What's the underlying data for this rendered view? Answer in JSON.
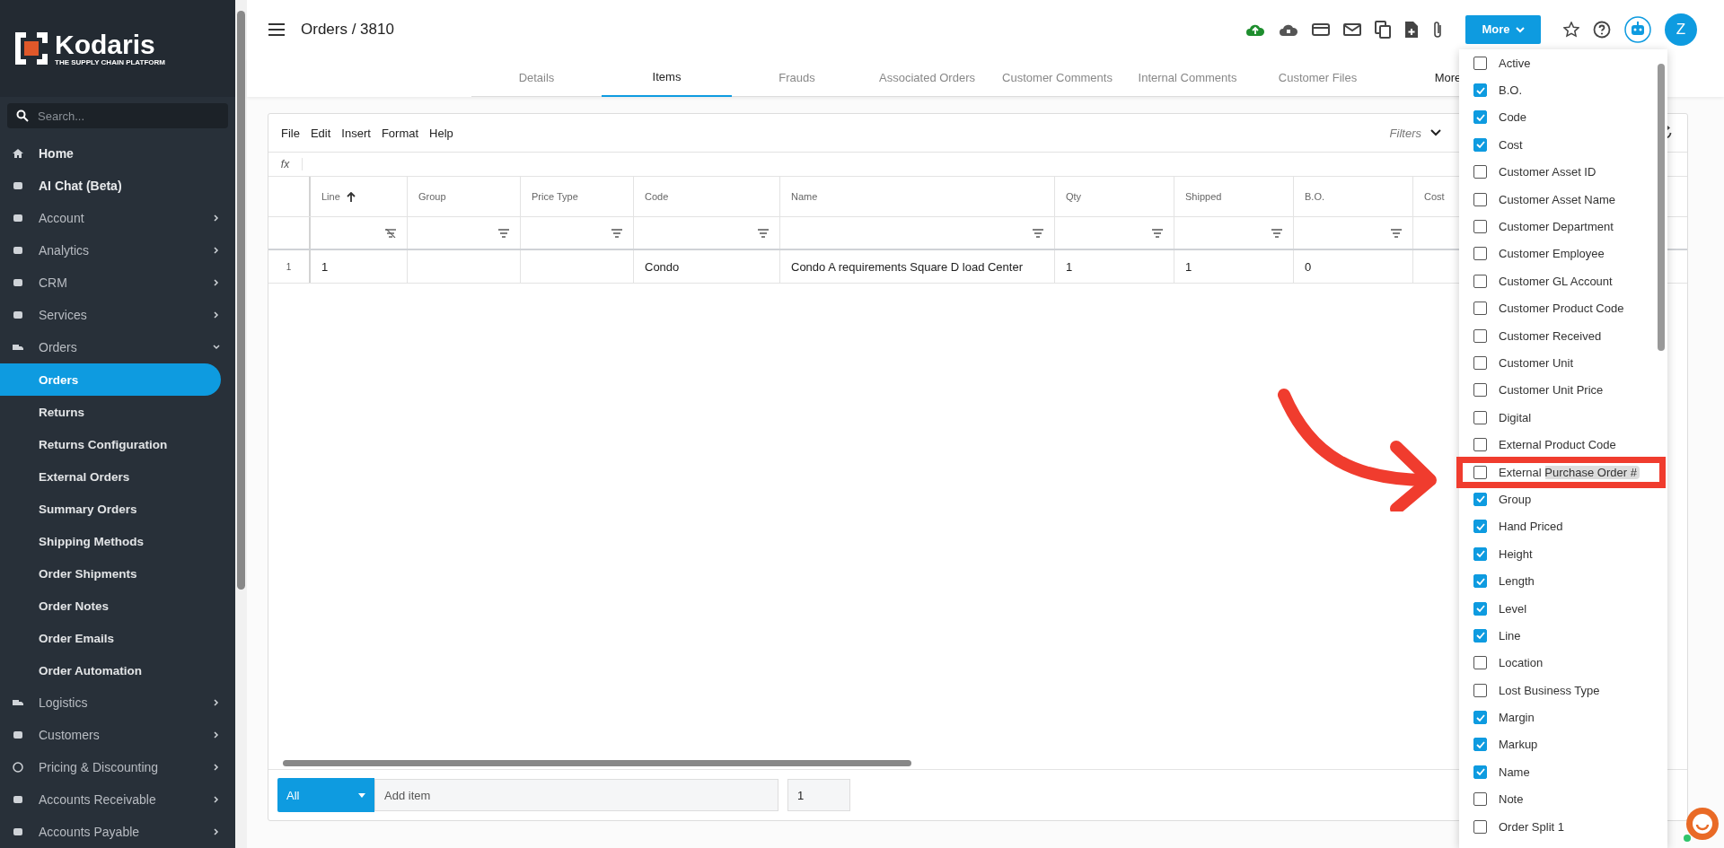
{
  "sidebar": {
    "logo": {
      "name": "Kodaris",
      "tagline": "THE SUPPLY CHAIN PLATFORM"
    },
    "search": {
      "placeholder": "Search..."
    },
    "items": [
      {
        "label": "Home",
        "kind": "link"
      },
      {
        "label": "AI Chat (Beta)",
        "kind": "link"
      },
      {
        "label": "Account",
        "kind": "group",
        "expanded": false
      },
      {
        "label": "Analytics",
        "kind": "group",
        "expanded": false
      },
      {
        "label": "CRM",
        "kind": "group",
        "expanded": false
      },
      {
        "label": "Services",
        "kind": "group",
        "expanded": false
      },
      {
        "label": "Orders",
        "kind": "group",
        "expanded": true,
        "children": [
          {
            "label": "Orders",
            "selected": true
          },
          {
            "label": "Returns",
            "selected": false
          },
          {
            "label": "Returns Configuration",
            "selected": false
          },
          {
            "label": "External Orders",
            "selected": false
          },
          {
            "label": "Summary Orders",
            "selected": false
          },
          {
            "label": "Shipping Methods",
            "selected": false
          },
          {
            "label": "Order Shipments",
            "selected": false
          },
          {
            "label": "Order Notes",
            "selected": false
          },
          {
            "label": "Order Emails",
            "selected": false
          },
          {
            "label": "Order Automation",
            "selected": false
          }
        ]
      },
      {
        "label": "Logistics",
        "kind": "group",
        "expanded": false
      },
      {
        "label": "Customers",
        "kind": "group",
        "expanded": false
      },
      {
        "label": "Pricing & Discounting",
        "kind": "group",
        "expanded": false
      },
      {
        "label": "Accounts Receivable",
        "kind": "group",
        "expanded": false
      },
      {
        "label": "Accounts Payable",
        "kind": "group",
        "expanded": false
      }
    ]
  },
  "header": {
    "title": "Orders / 3810",
    "more_button": "More",
    "avatar": "Z"
  },
  "tabs": [
    {
      "label": "Details",
      "selected": false
    },
    {
      "label": "Items",
      "selected": true
    },
    {
      "label": "Frauds",
      "selected": false
    },
    {
      "label": "Associated Orders",
      "selected": false
    },
    {
      "label": "Customer Comments",
      "selected": false
    },
    {
      "label": "Internal Comments",
      "selected": false
    },
    {
      "label": "Customer Files",
      "selected": false
    },
    {
      "label": "More",
      "selected": false
    }
  ],
  "sheet": {
    "menu": [
      "File",
      "Edit",
      "Insert",
      "Format",
      "Help"
    ],
    "filters": "Filters",
    "formula_label": "fx",
    "columns": [
      {
        "label": "Line",
        "sorted": true
      },
      {
        "label": "Group",
        "sorted": false
      },
      {
        "label": "Price Type",
        "sorted": false
      },
      {
        "label": "Code",
        "sorted": false
      },
      {
        "label": "Name",
        "sorted": false
      },
      {
        "label": "Qty",
        "sorted": false
      },
      {
        "label": "Shipped",
        "sorted": false
      },
      {
        "label": "B.O.",
        "sorted": false
      },
      {
        "label": "Cost",
        "sorted": false
      }
    ],
    "rows": [
      {
        "number": "1",
        "cells": [
          "1",
          "",
          "",
          "Condo",
          "Condo A requirements Square D load Center",
          "1",
          "1",
          "0",
          ""
        ]
      }
    ],
    "footer": {
      "type_select": "All",
      "add_placeholder": "Add item",
      "quantity": "1"
    }
  },
  "column_menu": [
    {
      "label": "Active",
      "checked": false,
      "highlighted": false
    },
    {
      "label": "B.O.",
      "checked": true,
      "highlighted": false
    },
    {
      "label": "Code",
      "checked": true,
      "highlighted": false
    },
    {
      "label": "Cost",
      "checked": true,
      "highlighted": false
    },
    {
      "label": "Customer Asset ID",
      "checked": false,
      "highlighted": false
    },
    {
      "label": "Customer Asset Name",
      "checked": false,
      "highlighted": false
    },
    {
      "label": "Customer Department",
      "checked": false,
      "highlighted": false
    },
    {
      "label": "Customer Employee",
      "checked": false,
      "highlighted": false
    },
    {
      "label": "Customer GL Account",
      "checked": false,
      "highlighted": false
    },
    {
      "label": "Customer Product Code",
      "checked": false,
      "highlighted": false
    },
    {
      "label": "Customer Received",
      "checked": false,
      "highlighted": false
    },
    {
      "label": "Customer Unit",
      "checked": false,
      "highlighted": false
    },
    {
      "label": "Customer Unit Price",
      "checked": false,
      "highlighted": false
    },
    {
      "label": "Digital",
      "checked": false,
      "highlighted": false
    },
    {
      "label": "External Product Code",
      "checked": false,
      "highlighted": false
    },
    {
      "label": "External Purchase Order #",
      "checked": false,
      "highlighted": true,
      "annotated": true
    },
    {
      "label": "Group",
      "checked": true,
      "highlighted": false
    },
    {
      "label": "Hand Priced",
      "checked": true,
      "highlighted": false
    },
    {
      "label": "Height",
      "checked": true,
      "highlighted": false
    },
    {
      "label": "Length",
      "checked": true,
      "highlighted": false
    },
    {
      "label": "Level",
      "checked": true,
      "highlighted": false
    },
    {
      "label": "Line",
      "checked": true,
      "highlighted": false
    },
    {
      "label": "Location",
      "checked": false,
      "highlighted": false
    },
    {
      "label": "Lost Business Type",
      "checked": false,
      "highlighted": false
    },
    {
      "label": "Margin",
      "checked": true,
      "highlighted": false
    },
    {
      "label": "Markup",
      "checked": true,
      "highlighted": false
    },
    {
      "label": "Name",
      "checked": true,
      "highlighted": false
    },
    {
      "label": "Note",
      "checked": false,
      "highlighted": false
    },
    {
      "label": "Order Split 1",
      "checked": false,
      "highlighted": false
    }
  ]
}
